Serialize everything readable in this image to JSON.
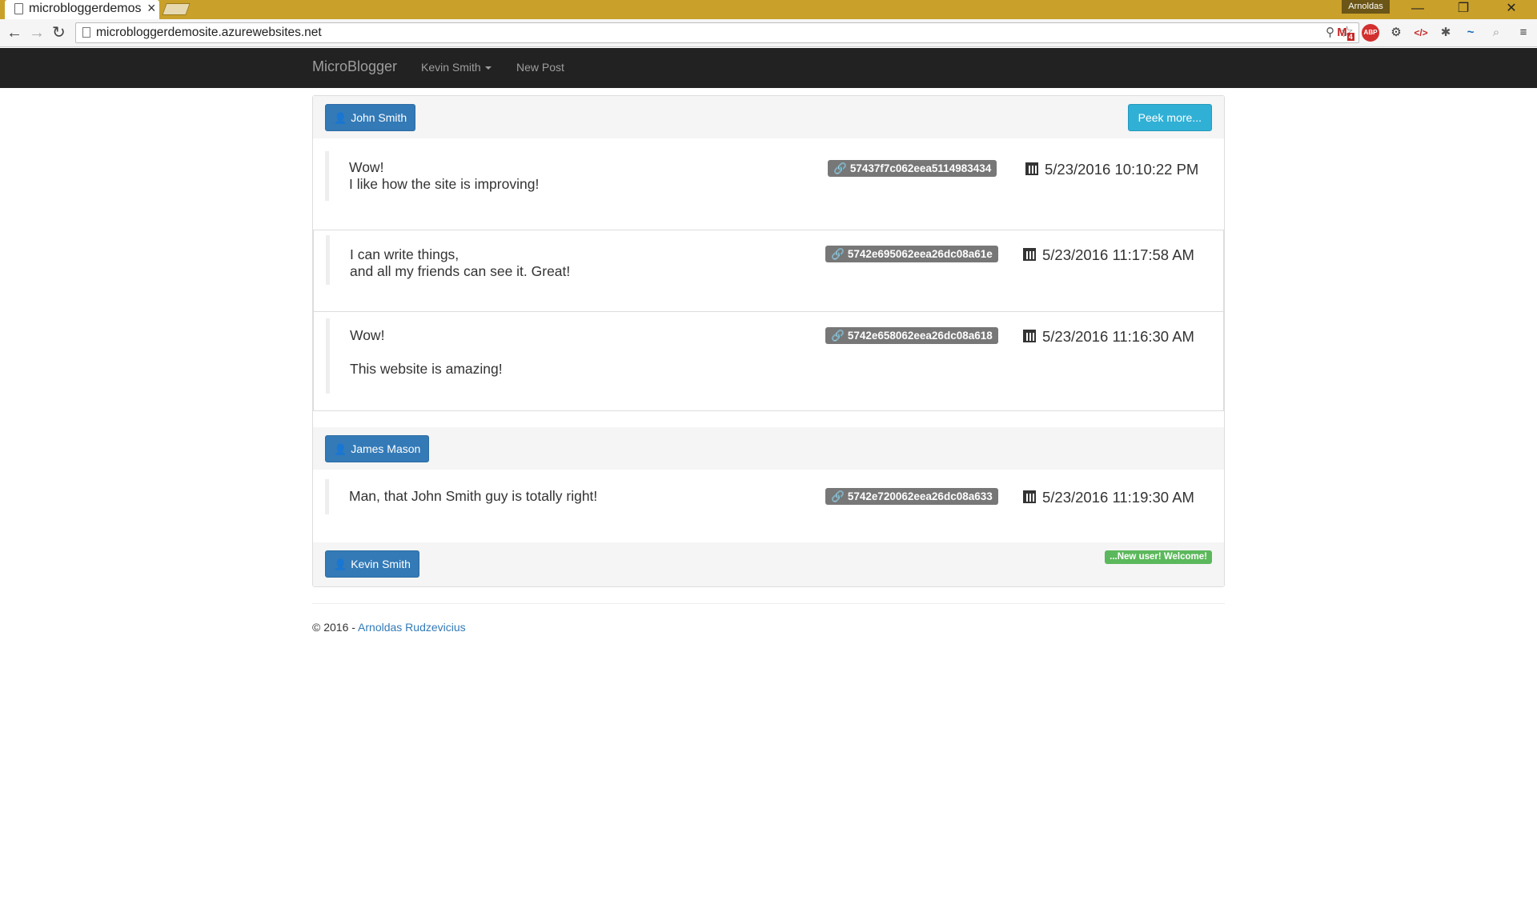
{
  "browser": {
    "tab_title": "microbloggerdemosite.azurewebsites.net",
    "url": "microbloggerdemosite.azurewebsites.net",
    "profile_name": "Arnoldas",
    "gmail_badge": "4",
    "abp_label": "ABP"
  },
  "navbar": {
    "brand": "MicroBlogger",
    "user_menu": "Kevin Smith",
    "new_post": "New Post"
  },
  "feed": {
    "peek_more": "Peek more...",
    "new_user_badge": "...New user! Welcome!",
    "groups": [
      {
        "author": "John Smith",
        "posts": [
          {
            "line1": "Wow!",
            "line2": "I like how the site is improving!",
            "id": "57437f7c062eea5114983434",
            "timestamp": "5/23/2016 10:10:22 PM"
          },
          {
            "line1": "I can write things,",
            "line2": "and all my friends can see it. Great!",
            "id": "5742e695062eea26dc08a61e",
            "timestamp": "5/23/2016 11:17:58 AM"
          },
          {
            "line1": "Wow!",
            "line2": "This website is amazing!",
            "id": "5742e658062eea26dc08a618",
            "timestamp": "5/23/2016 11:16:30 AM"
          }
        ]
      },
      {
        "author": "James Mason",
        "posts": [
          {
            "line1": "Man, that John Smith guy is totally right!",
            "id": "5742e720062eea26dc08a633",
            "timestamp": "5/23/2016 11:19:30 AM"
          }
        ]
      },
      {
        "author": "Kevin Smith",
        "posts": []
      }
    ]
  },
  "footer": {
    "copyright": "© 2016 - ",
    "author_link": "Arnoldas Rudzevicius"
  },
  "icons": {
    "user": "user-icon",
    "link": "link-icon",
    "calendar": "calendar-icon"
  },
  "colors": {
    "navbar_bg": "#222222",
    "primary": "#337ab7",
    "info": "#31b0d5",
    "success": "#5cb85c",
    "label_default": "#777777",
    "title_bar": "#c9a02a"
  }
}
